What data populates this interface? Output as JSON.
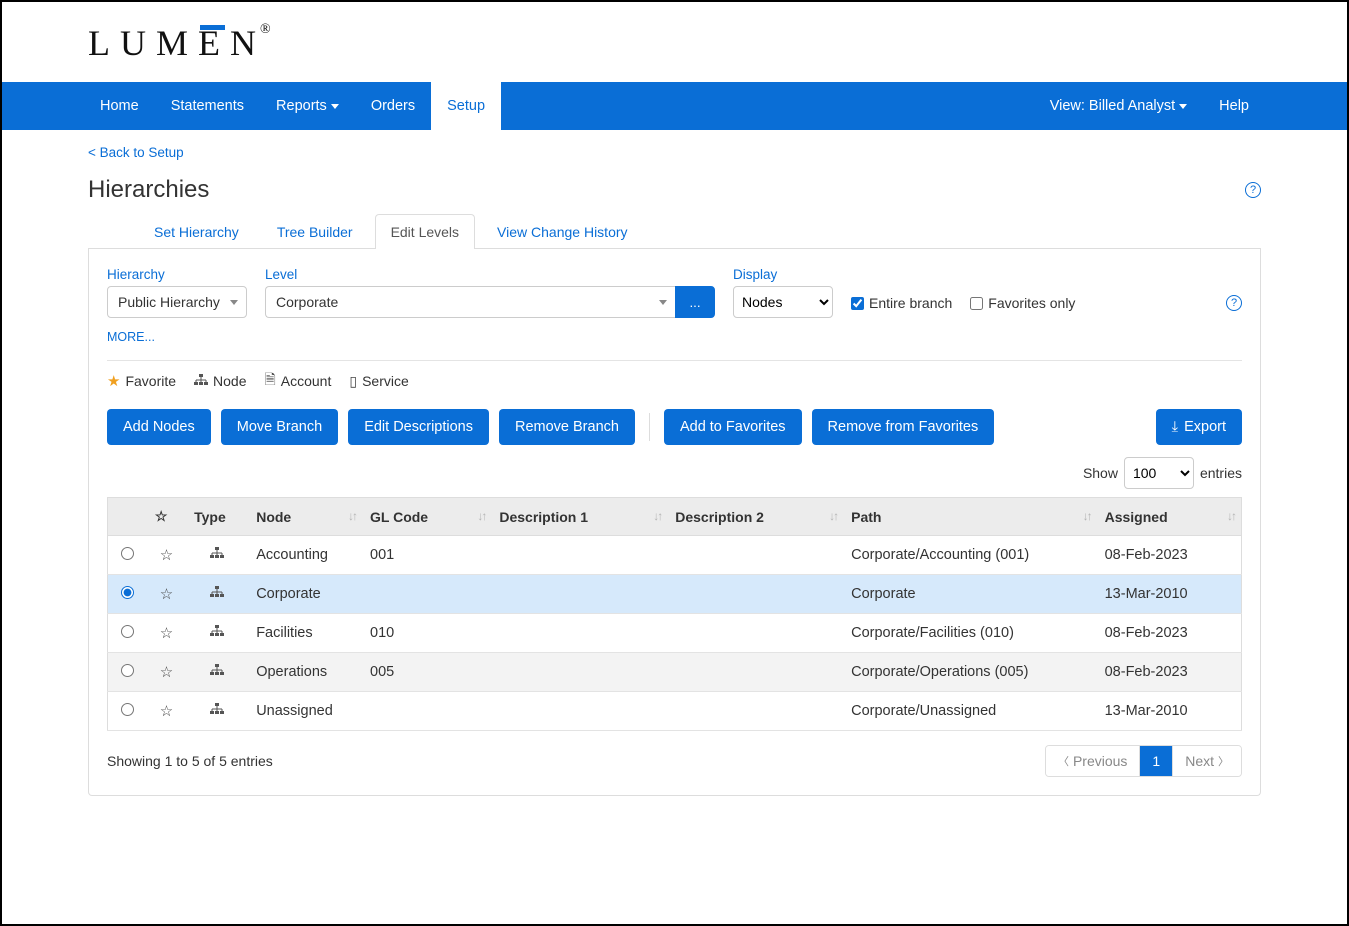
{
  "logo_text": "LUMEN",
  "nav": {
    "left": [
      "Home",
      "Statements",
      "Reports",
      "Orders",
      "Setup"
    ],
    "left_dropdown_idx": [
      2
    ],
    "left_active_idx": 4,
    "view_label": "View: Billed Analyst",
    "help_label": "Help"
  },
  "back_link": "< Back to Setup",
  "page_title": "Hierarchies",
  "tabs": {
    "items": [
      "Set Hierarchy",
      "Tree Builder",
      "Edit Levels",
      "View Change History"
    ],
    "active_idx": 2
  },
  "filters": {
    "hierarchy_label": "Hierarchy",
    "hierarchy_value": "Public Hierarchy",
    "level_label": "Level",
    "level_value": "Corporate",
    "level_more_btn": "...",
    "display_label": "Display",
    "display_value": "Nodes",
    "entire_branch_label": "Entire branch",
    "entire_branch_checked": true,
    "favorites_only_label": "Favorites only",
    "favorites_only_checked": false,
    "more_link": "MORE..."
  },
  "legend": {
    "favorite": "Favorite",
    "node": "Node",
    "account": "Account",
    "service": "Service"
  },
  "actions": {
    "add_nodes": "Add Nodes",
    "move_branch": "Move Branch",
    "edit_descriptions": "Edit Descriptions",
    "remove_branch": "Remove Branch",
    "add_to_favorites": "Add to Favorites",
    "remove_from_favorites": "Remove from Favorites",
    "export": "Export"
  },
  "show_entries": {
    "show": "Show",
    "value": "100",
    "entries": "entries"
  },
  "table": {
    "headers": {
      "fav": "☆",
      "type": "Type",
      "node": "Node",
      "gl": "GL Code",
      "desc1": "Description 1",
      "desc2": "Description 2",
      "path": "Path",
      "assigned": "Assigned"
    },
    "rows": [
      {
        "selected": false,
        "node": "Accounting",
        "gl": "001",
        "desc1": "",
        "desc2": "",
        "path": "Corporate/Accounting (001)",
        "assigned": "08-Feb-2023"
      },
      {
        "selected": true,
        "node": "Corporate",
        "gl": "",
        "desc1": "",
        "desc2": "",
        "path": "Corporate",
        "assigned": "13-Mar-2010"
      },
      {
        "selected": false,
        "node": "Facilities",
        "gl": "010",
        "desc1": "",
        "desc2": "",
        "path": "Corporate/Facilities (010)",
        "assigned": "08-Feb-2023"
      },
      {
        "selected": false,
        "node": "Operations",
        "gl": "005",
        "desc1": "",
        "desc2": "",
        "path": "Corporate/Operations (005)",
        "assigned": "08-Feb-2023"
      },
      {
        "selected": false,
        "node": "Unassigned",
        "gl": "",
        "desc1": "",
        "desc2": "",
        "path": "Corporate/Unassigned",
        "assigned": "13-Mar-2010"
      }
    ]
  },
  "table_footer": {
    "showing": "Showing 1 to 5 of 5 entries",
    "previous": "Previous",
    "page": "1",
    "next": "Next"
  }
}
